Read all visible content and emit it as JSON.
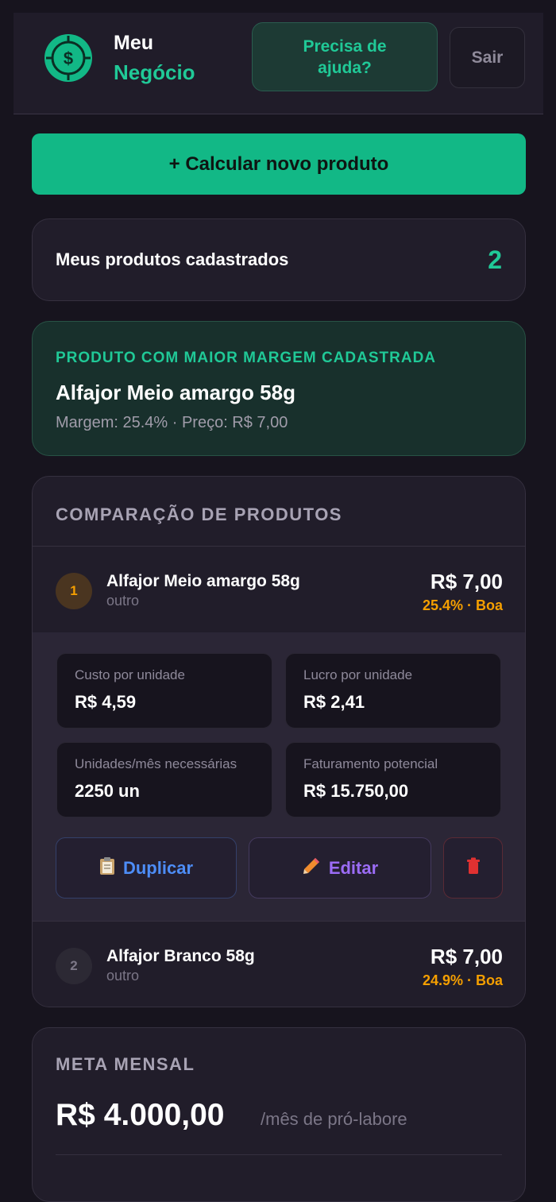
{
  "header": {
    "brand_line1": "Meu",
    "brand_line2": "Negócio",
    "help_label": "Precisa de ajuda?",
    "exit_label": "Sair"
  },
  "actions": {
    "calculate_label": "+ Calcular novo produto"
  },
  "products_summary": {
    "label": "Meus produtos cadastrados",
    "count": "2"
  },
  "best_product": {
    "kicker": "PRODUTO COM MAIOR MARGEM CADASTRADA",
    "name": "Alfajor Meio amargo 58g",
    "meta": "Margem: 25.4% · Preço: R$ 7,00"
  },
  "comparison": {
    "title": "COMPARAÇÃO DE PRODUTOS",
    "products": [
      {
        "rank": "1",
        "name": "Alfajor Meio amargo 58g",
        "category": "outro",
        "price": "R$ 7,00",
        "margin": "25.4% · Boa"
      },
      {
        "rank": "2",
        "name": "Alfajor Branco 58g",
        "category": "outro",
        "price": "R$ 7,00",
        "margin": "24.9% · Boa"
      }
    ],
    "details": {
      "cost_label": "Custo por unidade",
      "cost_value": "R$ 4,59",
      "profit_label": "Lucro por unidade",
      "profit_value": "R$ 2,41",
      "units_label": "Unidades/mês necessárias",
      "units_value": "2250 un",
      "revenue_label": "Faturamento potencial",
      "revenue_value": "R$ 15.750,00",
      "duplicate_label": "Duplicar",
      "edit_label": "Editar"
    }
  },
  "goal": {
    "title": "META MENSAL",
    "value": "R$ 4.000,00",
    "suffix": "/mês de pró-labore"
  },
  "colors": {
    "background": "#17141e",
    "accent": "#12b886",
    "accent_text": "#20c997",
    "warning": "#f59f00",
    "duplicate": "#4d8df7",
    "edit": "#9b6cf5",
    "danger": "#e03131"
  },
  "icons": {
    "logo": "dollar-target-icon",
    "duplicate": "clipboard-icon",
    "edit": "pencil-icon",
    "delete": "trash-icon"
  }
}
